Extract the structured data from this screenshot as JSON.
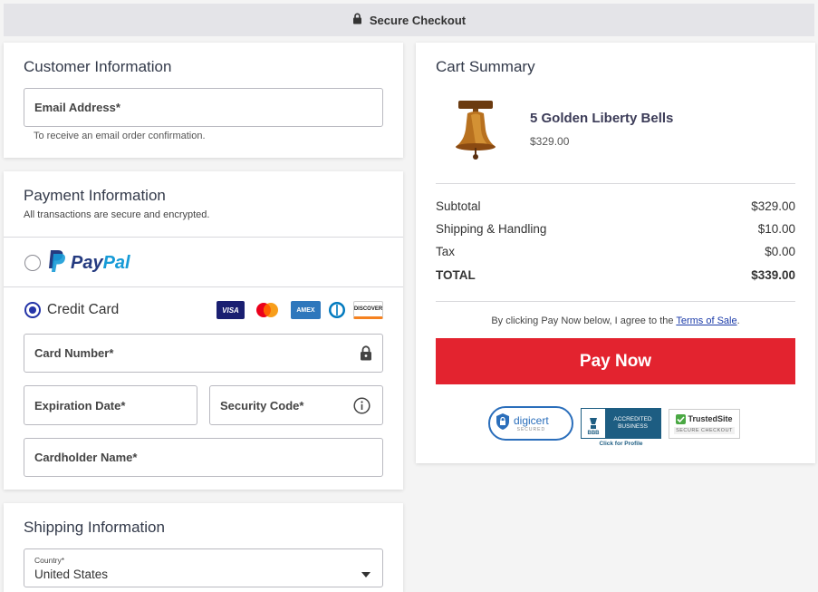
{
  "header": {
    "title": "Secure Checkout",
    "icon": "lock-icon"
  },
  "customer": {
    "title": "Customer Information",
    "email_label": "Email Address*",
    "email_hint": "To receive an email order confirmation."
  },
  "payment": {
    "title": "Payment Information",
    "subtitle": "All transactions are secure and encrypted.",
    "paypal_label_p1": "Pay",
    "paypal_label_p2": "Pal",
    "credit_label": "Credit Card",
    "selected_method": "Credit Card",
    "card_brands": [
      "VISA",
      "Mastercard",
      "AMEX",
      "Diners",
      "DISCOVER"
    ],
    "card_number_label": "Card Number*",
    "expiration_label": "Expiration Date*",
    "security_label": "Security Code*",
    "cardholder_label": "Cardholder Name*"
  },
  "shipping": {
    "title": "Shipping Information",
    "country_label": "Country*",
    "country_value": "United States"
  },
  "cart": {
    "title": "Cart Summary",
    "item_name": "5 Golden Liberty Bells",
    "item_price": "$329.00",
    "rows": [
      {
        "label": "Subtotal",
        "value": "$329.00"
      },
      {
        "label": "Shipping & Handling",
        "value": "$10.00"
      },
      {
        "label": "Tax",
        "value": "$0.00"
      }
    ],
    "total_label": "TOTAL",
    "total_value": "$339.00",
    "terms_prefix": "By clicking Pay Now below, I agree to the ",
    "terms_link": "Terms of Sale",
    "terms_suffix": ".",
    "pay_button": "Pay Now"
  },
  "trust": {
    "digicert": "digicert",
    "digicert_sub": "SECURED",
    "bbb_line1": "ACCREDITED",
    "bbb_line2": "BUSINESS",
    "bbb_logo": "BBB",
    "bbb_caption": "Click for Profile",
    "trustedsite": "TrustedSite",
    "trustedsite_sub": "SECURE CHECKOUT"
  },
  "colors": {
    "accent": "#2535a8",
    "pay_button": "#e3232f",
    "paypal_dark": "#253b80",
    "paypal_light": "#179bd7"
  }
}
